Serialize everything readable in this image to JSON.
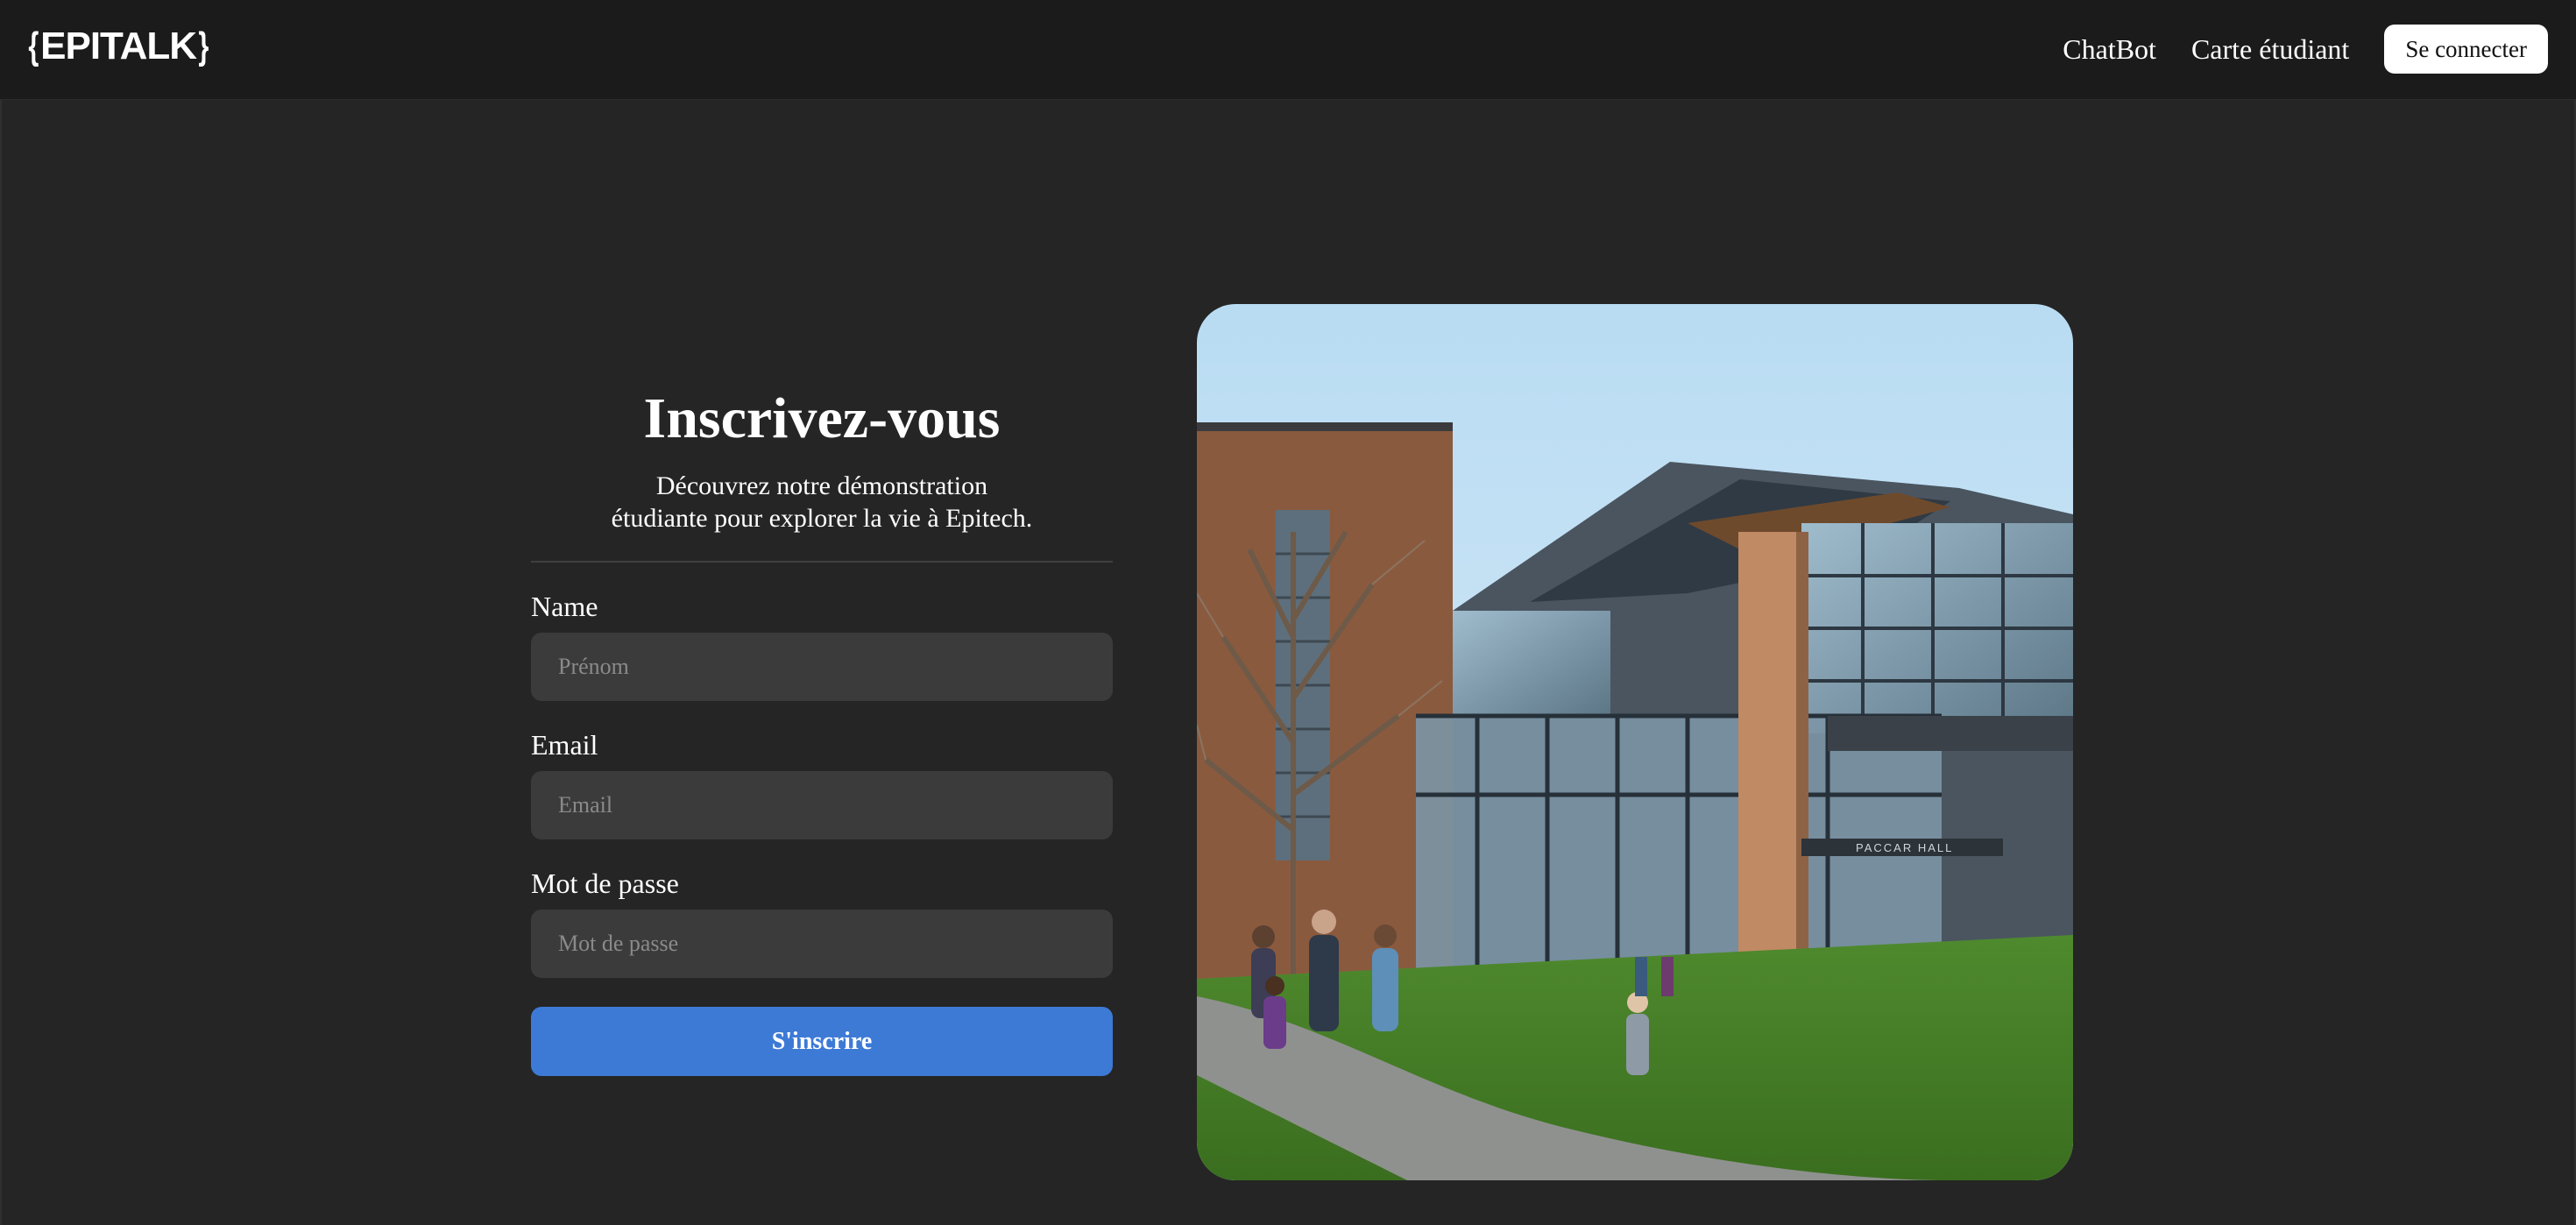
{
  "header": {
    "logo": "EPITALK",
    "nav": {
      "chatbot_label": "ChatBot",
      "student_card_label": "Carte étudiant",
      "login_label": "Se connecter"
    }
  },
  "signup": {
    "title": "Inscrivez-vous",
    "subtitle_line1": "Découvrez notre démonstration",
    "subtitle_line2": "étudiante pour explorer la vie à Epitech.",
    "fields": {
      "name": {
        "label": "Name",
        "placeholder": "Prénom",
        "value": ""
      },
      "email": {
        "label": "Email",
        "placeholder": "Email",
        "value": ""
      },
      "password": {
        "label": "Mot de passe",
        "placeholder": "Mot de passe",
        "value": ""
      }
    },
    "submit_label": "S'inscrire"
  },
  "image": {
    "building_sign": "PACCAR HALL"
  },
  "colors": {
    "background": "#252525",
    "header": "#1b1b1b",
    "input": "#3b3b3b",
    "accent": "#3d7ad6"
  }
}
